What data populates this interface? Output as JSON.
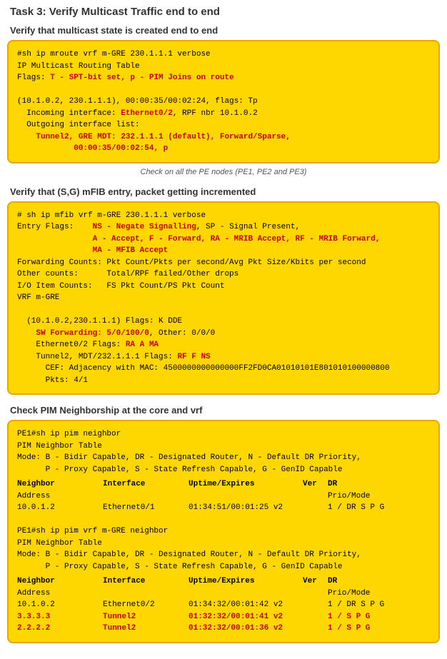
{
  "page": {
    "title": "Task 3: Verify Multicast Traffic end to end",
    "sections": [
      {
        "id": "section1",
        "header": "Verify that multicast state is created end to end",
        "code_lines": [
          {
            "text": "#sh ip mroute vrf m-GRE 230.1.1.1 verbose",
            "style": "normal"
          },
          {
            "text": "IP Multicast Routing Table",
            "style": "normal"
          },
          {
            "text": "Flags: T - SPT-bit set, p - PIM Joins on route",
            "style": "mixed",
            "parts": [
              {
                "text": "Flags: ",
                "style": "normal"
              },
              {
                "text": "T - SPT-bit set, p - PIM Joins on route",
                "style": "red"
              }
            ]
          },
          {
            "text": "",
            "style": "normal"
          },
          {
            "text": "(10.1.0.2, 230.1.1.1), 00:00:35/00:02:24, flags: Tp",
            "style": "normal"
          },
          {
            "text": "  Incoming interface: Ethernet0/2, RPF nbr 10.1.0.2",
            "style": "mixed",
            "parts": [
              {
                "text": "  Incoming interface: ",
                "style": "normal"
              },
              {
                "text": "Ethernet0/2",
                "style": "red"
              },
              {
                "text": ", RPF nbr 10.1.0.2",
                "style": "normal"
              }
            ]
          },
          {
            "text": "  Outgoing interface list:",
            "style": "normal"
          },
          {
            "text": "    Tunnel2, GRE MDT: 232.1.1.1 (default), Forward/Sparse,",
            "style": "red"
          },
          {
            "text": "            00:00:35/00:02:54, p",
            "style": "red"
          }
        ],
        "note": "Check on all the PE nodes (PE1, PE2 and PE3)"
      },
      {
        "id": "section2",
        "header": "Verify that (S,G) mFIB entry, packet getting incremented",
        "code_lines": [
          {
            "text": "# sh ip mfib vrf m-GRE 230.1.1.1 verbose",
            "style": "normal"
          },
          {
            "text": "Entry Flags:    NS - Negate Signalling, SP - Signal Present,",
            "style": "mixed",
            "parts": [
              {
                "text": "Entry Flags:    ",
                "style": "normal"
              },
              {
                "text": "NS - Negate Signalling",
                "style": "red"
              },
              {
                "text": ", SP - Signal Present,",
                "style": "normal"
              }
            ]
          },
          {
            "text": "                A - Accept, F - Forward, RA - MRIB Accept, RF - MRIB Forward,",
            "style": "mixed",
            "parts": [
              {
                "text": "                ",
                "style": "normal"
              },
              {
                "text": "A - Accept, F - Forward, RA - MRIB Accept, RF - MRIB Forward,",
                "style": "red"
              }
            ]
          },
          {
            "text": "                MA - MFIB Accept",
            "style": "mixed",
            "parts": [
              {
                "text": "                ",
                "style": "normal"
              },
              {
                "text": "MA - MFIB Accept",
                "style": "red"
              }
            ]
          },
          {
            "text": "Forwarding Counts: Pkt Count/Pkts per second/Avg Pkt Size/Kbits per second",
            "style": "normal"
          },
          {
            "text": "Other counts:      Total/RPF failed/Other drops",
            "style": "normal"
          },
          {
            "text": "I/O Item Counts:   FS Pkt Count/PS Pkt Count",
            "style": "normal"
          },
          {
            "text": "VRF m-GRE",
            "style": "normal"
          },
          {
            "text": "",
            "style": "normal"
          },
          {
            "text": "  (10.1.0.2,230.1.1.1) Flags: K DDE",
            "style": "normal"
          },
          {
            "text": "    SW Forwarding: 5/0/100/0, Other: 0/0/0",
            "style": "mixed",
            "parts": [
              {
                "text": "    ",
                "style": "normal"
              },
              {
                "text": "SW Forwarding: 5/0/100/0",
                "style": "red"
              },
              {
                "text": ", Other: 0/0/0",
                "style": "normal"
              }
            ]
          },
          {
            "text": "    Ethernet0/2 Flags: RA A MA",
            "style": "mixed",
            "parts": [
              {
                "text": "    Ethernet0/2 Flags: ",
                "style": "normal"
              },
              {
                "text": "RA A MA",
                "style": "red"
              }
            ]
          },
          {
            "text": "    Tunnel2, MDT/232.1.1.1 Flags: RF F NS",
            "style": "mixed",
            "parts": [
              {
                "text": "    Tunnel2, MDT/232.1.1.1 Flags: ",
                "style": "normal"
              },
              {
                "text": "RF F NS",
                "style": "red"
              }
            ]
          },
          {
            "text": "      CEF: Adjacency with MAC: 4500000000000000FF2FD0CA01010101E801010100000800",
            "style": "normal"
          },
          {
            "text": "      Pkts: 4/1",
            "style": "normal"
          }
        ],
        "note": ""
      },
      {
        "id": "section3",
        "header": "Check PIM Neighborship at the core and vrf",
        "code_lines": [
          {
            "text": "PE1#sh ip pim neighbor",
            "style": "normal"
          },
          {
            "text": "PIM Neighbor Table",
            "style": "normal"
          },
          {
            "text": "Mode: B - Bidir Capable, DR - Designated Router, N - Default DR Priority,",
            "style": "normal"
          },
          {
            "text": "      P - Proxy Capable, S - State Refresh Capable, G - GenID Capable",
            "style": "normal"
          }
        ],
        "table1": {
          "headers": [
            "Neighbor",
            "Interface",
            "Uptime/Expires",
            "Ver",
            "DR"
          ],
          "subheaders": [
            "Address",
            "",
            "",
            "",
            "Prio/Mode"
          ],
          "rows": [
            {
              "neighbor": "10.0.1.2",
              "interface": "Ethernet0/1",
              "uptime": "01:34:51/00:01:25 v2",
              "ver": "",
              "dr": "1 / DR S P G",
              "style": "normal"
            }
          ]
        },
        "code_lines2": [
          {
            "text": "",
            "style": "normal"
          },
          {
            "text": "PE1#sh ip pim vrf m-GRE neighbor",
            "style": "normal"
          },
          {
            "text": "PIM Neighbor Table",
            "style": "normal"
          },
          {
            "text": "Mode: B - Bidir Capable, DR - Designated Router, N - Default DR Priority,",
            "style": "normal"
          },
          {
            "text": "      P - Proxy Capable, S - State Refresh Capable, G - GenID Capable",
            "style": "normal"
          }
        ],
        "table2": {
          "headers": [
            "Neighbor",
            "Interface",
            "Uptime/Expires",
            "Ver",
            "DR"
          ],
          "subheaders": [
            "Address",
            "",
            "",
            "",
            "Prio/Mode"
          ],
          "rows": [
            {
              "neighbor": "10.1.0.2",
              "interface": "Ethernet0/2",
              "uptime": "01:34:32/00:01:42 v2",
              "ver": "",
              "dr": "1 / DR S P G",
              "style": "normal"
            },
            {
              "neighbor": "3.3.3.3",
              "interface": "Tunnel2",
              "uptime": "01:32:32/00:01:41 v2",
              "ver": "",
              "dr": "1 / S P G",
              "style": "red"
            },
            {
              "neighbor": "2.2.2.2",
              "interface": "Tunnel2",
              "uptime": "01:32:32/00:01:36 v2",
              "ver": "",
              "dr": "1 / S P G",
              "style": "red"
            }
          ]
        }
      }
    ]
  }
}
